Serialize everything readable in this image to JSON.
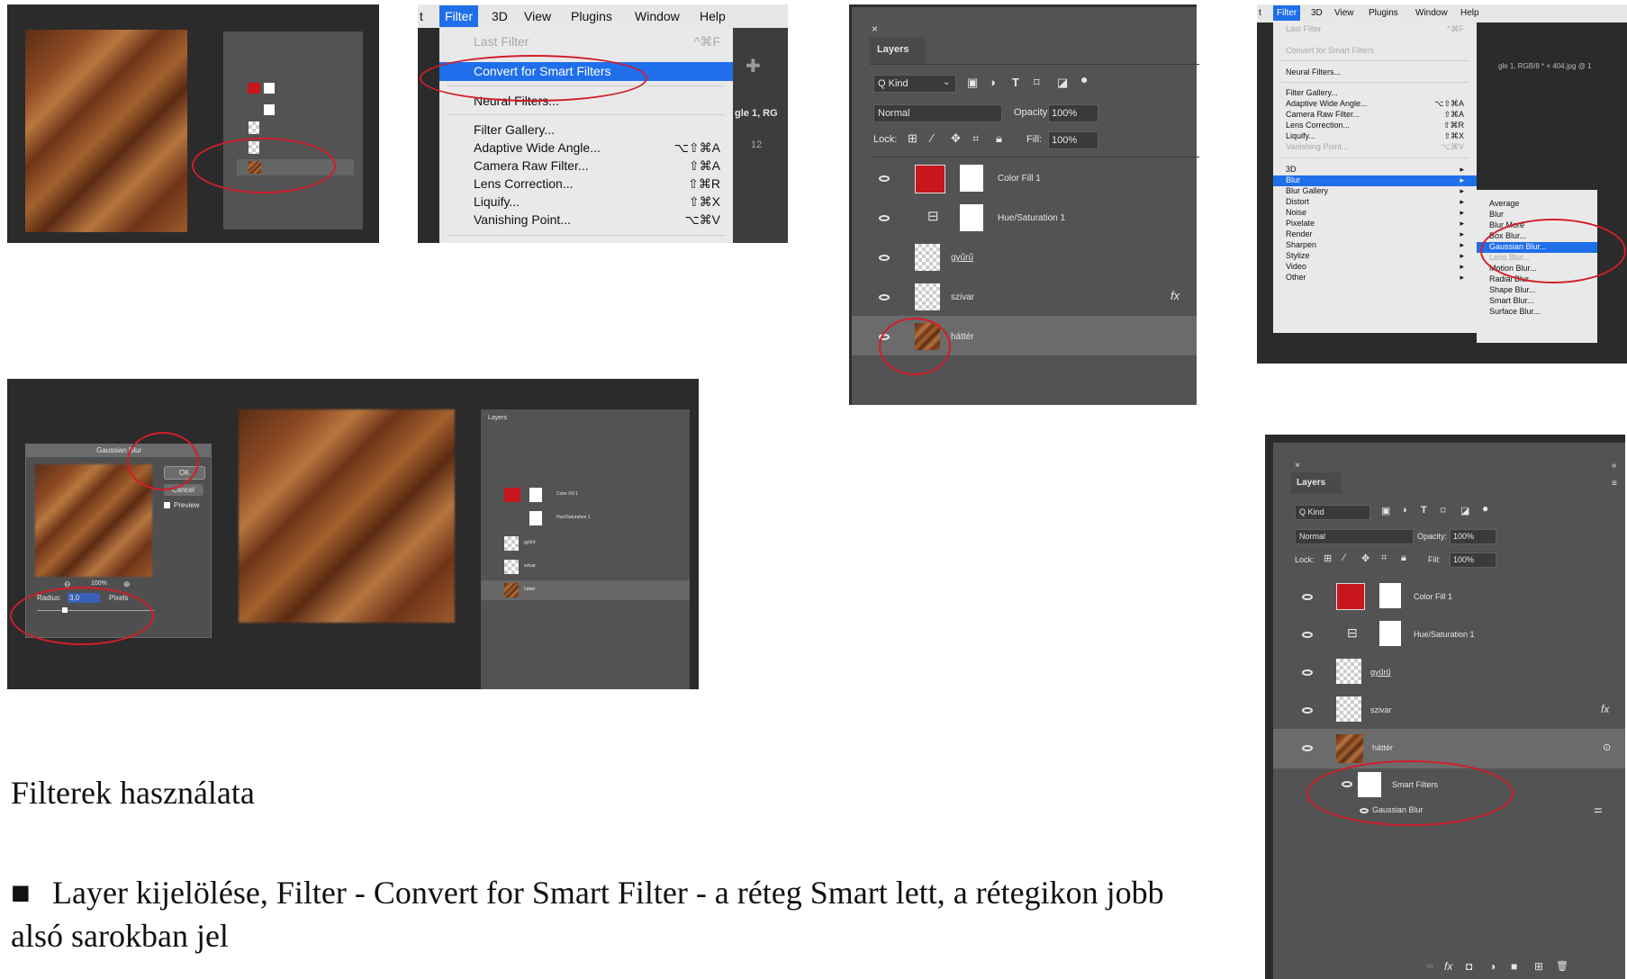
{
  "slide": {
    "heading": "Filterek használata",
    "bullet_marker": "■",
    "bullet_text": "Layer kijelölése, Filter - Convert for Smart Filter - a réteg Smart lett, a rétegikon jobb alsó sarokban jel"
  },
  "menu_bar_1": {
    "items": [
      "t",
      "Filter",
      "3D",
      "View",
      "Plugins",
      "Window",
      "Help"
    ],
    "active": "Filter",
    "tail": "gle 1, RG",
    "ruler": "12"
  },
  "filter_menu_1": {
    "items": [
      {
        "label": "Last Filter",
        "shortcut": "^⌘F",
        "disabled": true
      },
      {
        "label": "Convert for Smart Filters",
        "shortcut": "",
        "highlight": true
      },
      {
        "label": "Neural Filters...",
        "shortcut": ""
      },
      {
        "label": "Filter Gallery...",
        "shortcut": ""
      },
      {
        "label": "Adaptive Wide Angle...",
        "shortcut": "⌥⇧⌘A"
      },
      {
        "label": "Camera Raw Filter...",
        "shortcut": "⇧⌘A"
      },
      {
        "label": "Lens Correction...",
        "shortcut": "⇧⌘R"
      },
      {
        "label": "Liquify...",
        "shortcut": "⇧⌘X"
      },
      {
        "label": "Vanishing Point...",
        "shortcut": "⌥⌘V"
      }
    ]
  },
  "layers_panel_large": {
    "title": "Layers",
    "close": "×",
    "kind": "Q Kind",
    "blend_mode": "Normal",
    "opacity_label": "Opacity:",
    "opacity_value": "100%",
    "lock_label": "Lock:",
    "fill_label": "Fill:",
    "fill_value": "100%",
    "fx": "fx",
    "layers": [
      "Color Fill 1",
      "Hue/Saturation 1",
      "gyűrű",
      "szivar",
      "háttér"
    ]
  },
  "menu_bar_2": {
    "items": [
      "t",
      "Filter",
      "3D",
      "View",
      "Plugins",
      "Window",
      "Help"
    ],
    "tail": "gle 1, RGB/8 *  ×  404.jpg @ 1"
  },
  "filter_menu_2": {
    "items": [
      {
        "label": "Last Filter",
        "shortcut": "^⌘F",
        "disabled": true
      },
      {
        "label": "Convert for Smart Filters",
        "shortcut": "",
        "disabled": true
      },
      {
        "label": "Neural Filters...",
        "shortcut": ""
      },
      {
        "label": "Filter Gallery...",
        "shortcut": ""
      },
      {
        "label": "Adaptive Wide Angle...",
        "shortcut": "⌥⇧⌘A"
      },
      {
        "label": "Camera Raw Filter...",
        "shortcut": "⇧⌘A"
      },
      {
        "label": "Lens Correction...",
        "shortcut": "⇧⌘R"
      },
      {
        "label": "Liquify...",
        "shortcut": "⇧⌘X"
      },
      {
        "label": "Vanishing Point...",
        "shortcut": "⌥⌘V",
        "disabled": true
      },
      {
        "label": "3D",
        "shortcut": "▸"
      },
      {
        "label": "Blur",
        "shortcut": "▸",
        "highlight": true
      },
      {
        "label": "Blur Gallery",
        "shortcut": "▸"
      },
      {
        "label": "Distort",
        "shortcut": "▸"
      },
      {
        "label": "Noise",
        "shortcut": "▸"
      },
      {
        "label": "Pixelate",
        "shortcut": "▸"
      },
      {
        "label": "Render",
        "shortcut": "▸"
      },
      {
        "label": "Sharpen",
        "shortcut": "▸"
      },
      {
        "label": "Stylize",
        "shortcut": "▸"
      },
      {
        "label": "Video",
        "shortcut": "▸"
      },
      {
        "label": "Other",
        "shortcut": "▸"
      }
    ],
    "submenu": [
      {
        "label": "Average"
      },
      {
        "label": "Blur"
      },
      {
        "label": "Blur More"
      },
      {
        "label": "Box Blur..."
      },
      {
        "label": "Gaussian Blur...",
        "highlight": true
      },
      {
        "label": "Lens Blur...",
        "disabled": true
      },
      {
        "label": "Motion Blur..."
      },
      {
        "label": "Radial Blur..."
      },
      {
        "label": "Shape Blur..."
      },
      {
        "label": "Smart Blur..."
      },
      {
        "label": "Surface Blur..."
      }
    ]
  },
  "gaussian_dialog": {
    "title": "Gaussian Blur",
    "ok": "OK",
    "cancel": "Cancel",
    "preview": "Preview",
    "zoom": "100%",
    "radius_label": "Radius:",
    "radius_value": "3,0",
    "unit": "Pixels"
  },
  "layers_panel_small_right": {
    "title": "Layers",
    "layers": [
      "Color Fill 1",
      "Hue/Saturation 1",
      "gyűrű",
      "szivar",
      "háttér"
    ]
  },
  "layers_panel_final": {
    "title": "Layers",
    "close": "×",
    "collapse": "«",
    "kind": "Q Kind",
    "blend_mode": "Normal",
    "opacity_label": "Opacity:",
    "opacity_value": "100%",
    "lock_label": "Lock:",
    "fill_label": "Fill:",
    "fill_value": "100%",
    "fx": "fx",
    "layers": [
      "Color Fill 1",
      "Hue/Saturation 1",
      "gyűrű",
      "szivar",
      "háttér"
    ],
    "smart_filters": "Smart Filters",
    "gaussian": "Gaussian Blur",
    "bottom_icons": [
      "∞",
      "fx",
      "◘",
      "◑",
      "■",
      "⊞",
      "🗑"
    ]
  },
  "colors": {
    "annotation": "#d21d2a",
    "highlight": "#1f6feb",
    "color_fill_swatch": "#c8161d",
    "ps_bg": "#2b2b2b",
    "panel_bg": "#535353"
  }
}
